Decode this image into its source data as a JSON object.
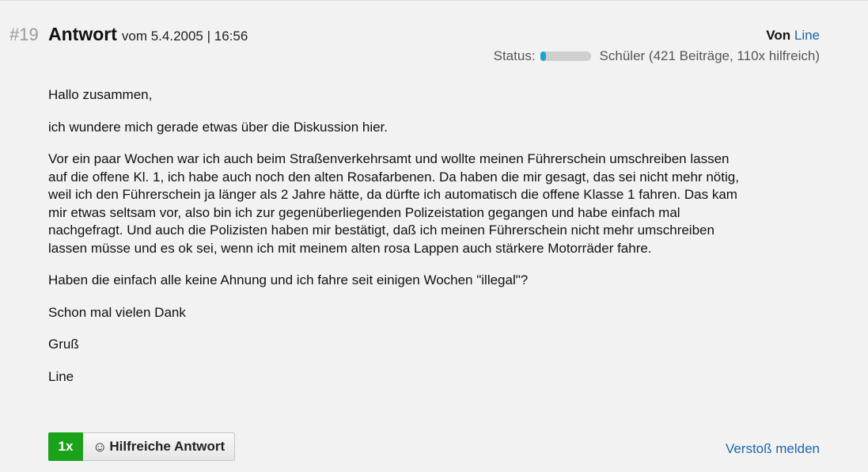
{
  "post": {
    "number": "#19",
    "title": "Antwort",
    "meta": "vom 5.4.2005 | 16:56",
    "author_prefix": "Von",
    "author_name": "Line",
    "status_label": "Status:",
    "status_level": 0.12,
    "status_text": "Schüler (421 Beiträge, 110x hilfreich)",
    "status_color": "#19a7c9"
  },
  "content": {
    "paragraphs": [
      "Hallo zusammen,",
      "ich wundere mich gerade etwas über die Diskussion hier.",
      "Vor ein paar Wochen war ich auch beim Straßenverkehrsamt und wollte meinen Führerschein umschreiben lassen auf die offene Kl. 1, ich habe auch noch den alten Rosafarbenen. Da haben die mir gesagt, das sei nicht mehr nötig, weil ich den Führerschein ja länger als 2 Jahre hätte, da dürfte ich automatisch die offene Klasse 1 fahren. Das kam mir etwas seltsam vor, also bin ich zur gegenüberliegenden Polizeistation gegangen und habe einfach mal nachgefragt. Und auch die Polizisten haben mir bestätigt, daß ich meinen Führerschein nicht mehr umschreiben lassen müsse und es ok sei, wenn ich mit meinem alten rosa Lappen auch stärkere Motorräder fahre.",
      "Haben die einfach alle keine Ahnung und ich fahre seit einigen Wochen \"illegal\"?",
      "Schon mal vielen Dank",
      "Gruß",
      "Line"
    ]
  },
  "actions": {
    "helpful_count": "1x",
    "helpful_icon": "smiley-icon",
    "helpful_symbol": "☺",
    "helpful_label": "Hilfreiche Antwort",
    "helpful_color": "#1aa31a",
    "report_label": "Verstoß melden",
    "link_color": "#1b67a8"
  }
}
